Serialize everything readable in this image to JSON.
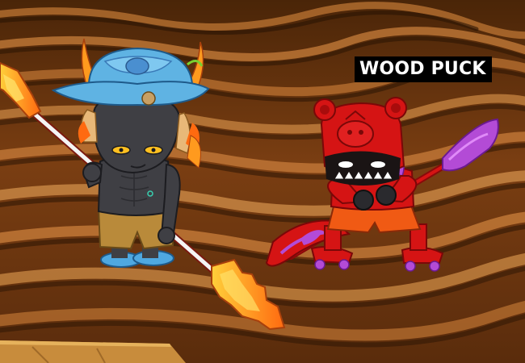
{
  "enemy": {
    "name": "WOOD PUCK"
  },
  "scene": {
    "terrain": "rippled-sand-dunes",
    "colors": {
      "sand_dark": "#3a1e08",
      "sand_mid": "#8a4a18",
      "sand_light": "#c47a36",
      "sand_highlight": "#e09a4e",
      "ground_ledge": "#c88c3c",
      "hero_skin": "#3f3f44",
      "hero_cap": "#5fb3e3",
      "hero_horn": "#ff9a1e",
      "hero_shorts": "#b98a3a",
      "spear_head": "#ff8a1c",
      "enemy_body": "#d51414",
      "enemy_accent": "#b34bd6",
      "enemy_shorts": "#f05a14"
    }
  },
  "hero": {
    "weapon": "double-ended-spear"
  },
  "foe": {
    "weapon": "twin-bladed-scythe"
  }
}
